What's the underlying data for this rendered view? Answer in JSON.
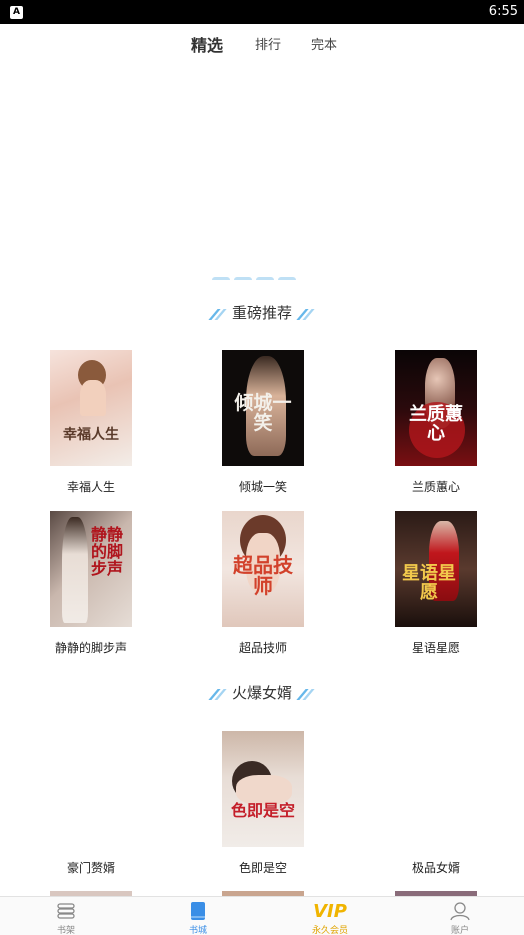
{
  "status_bar": {
    "notification_glyph": "A",
    "time": "6:55"
  },
  "top_tabs": [
    {
      "label": "精选",
      "active": true
    },
    {
      "label": "排行",
      "active": false
    },
    {
      "label": "完本",
      "active": false
    }
  ],
  "sections": [
    {
      "title": "重磅推荐"
    },
    {
      "title": "火爆女婿"
    }
  ],
  "books_featured": [
    {
      "title": "幸福人生",
      "cover_text": "幸福人生"
    },
    {
      "title": "倾城一笑",
      "cover_text": "倾城一笑"
    },
    {
      "title": "兰质蕙心",
      "cover_text": "兰质蕙心"
    },
    {
      "title": "静静的脚步声",
      "cover_text": "静静的脚步声"
    },
    {
      "title": "超品技师",
      "cover_text": "超品技师"
    },
    {
      "title": "星语星愿",
      "cover_text": "星语星愿"
    }
  ],
  "books_hot": [
    {
      "title": "豪门赘婿"
    },
    {
      "title": "色即是空",
      "cover_text": "色即是空"
    },
    {
      "title": "极品女婿"
    }
  ],
  "bottom_nav": [
    {
      "label": "书架",
      "icon": "bookshelf-icon",
      "active": false
    },
    {
      "label": "书城",
      "icon": "bookstore-icon",
      "active": true
    },
    {
      "label": "永久会员",
      "icon": "vip-icon",
      "active": false,
      "badge": "VIP"
    },
    {
      "label": "账户",
      "icon": "account-icon",
      "active": false
    }
  ],
  "colors": {
    "accent_blue": "#3a8ee6",
    "vip_gold": "#f0b400",
    "decoration_blue": "#66b7ea"
  }
}
